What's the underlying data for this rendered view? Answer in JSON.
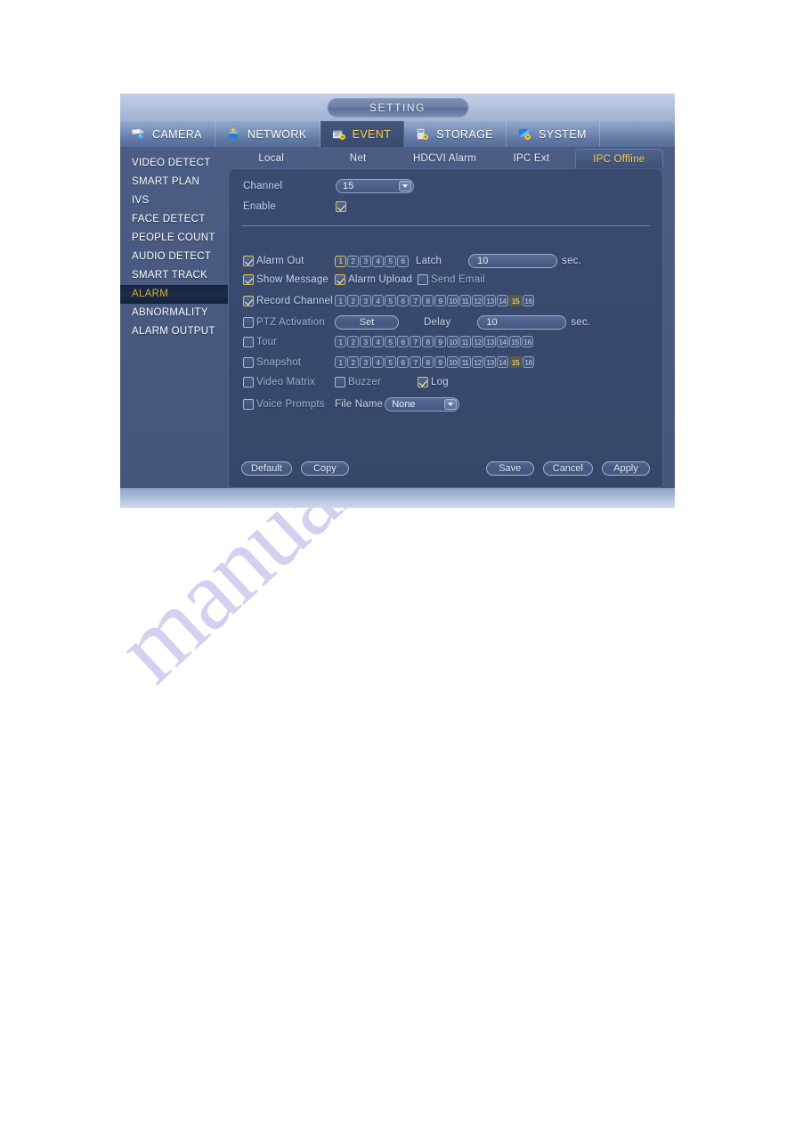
{
  "window": {
    "title": "SETTING"
  },
  "nav": {
    "tabs": [
      {
        "label": "CAMERA",
        "icon": "camera-icon",
        "active": false
      },
      {
        "label": "NETWORK",
        "icon": "network-icon",
        "active": false
      },
      {
        "label": "EVENT",
        "icon": "event-icon",
        "active": true
      },
      {
        "label": "STORAGE",
        "icon": "storage-icon",
        "active": false
      },
      {
        "label": "SYSTEM",
        "icon": "system-icon",
        "active": false
      }
    ]
  },
  "sidebar": {
    "items": [
      {
        "label": "VIDEO DETECT",
        "active": false
      },
      {
        "label": "SMART PLAN",
        "active": false
      },
      {
        "label": "IVS",
        "active": false
      },
      {
        "label": "FACE DETECT",
        "active": false
      },
      {
        "label": "PEOPLE COUNT",
        "active": false
      },
      {
        "label": "AUDIO DETECT",
        "active": false
      },
      {
        "label": "SMART TRACK",
        "active": false
      },
      {
        "label": "ALARM",
        "active": true
      },
      {
        "label": "ABNORMALITY",
        "active": false
      },
      {
        "label": "ALARM OUTPUT",
        "active": false
      }
    ]
  },
  "subtabs": [
    {
      "label": "Local",
      "active": false
    },
    {
      "label": "Net",
      "active": false
    },
    {
      "label": "HDCVI Alarm",
      "active": false
    },
    {
      "label": "IPC Ext",
      "active": false
    },
    {
      "label": "IPC Offline",
      "active": true
    }
  ],
  "form": {
    "channel": {
      "label": "Channel",
      "value": "15"
    },
    "enable": {
      "label": "Enable",
      "checked": true
    },
    "alarm_out": {
      "label": "Alarm Out",
      "checked": true,
      "channels": [
        "1",
        "2",
        "3",
        "4",
        "5",
        "6"
      ],
      "selected": [
        "1"
      ]
    },
    "latch": {
      "label": "Latch",
      "value": "10",
      "unit": "sec."
    },
    "show_message": {
      "label": "Show Message",
      "checked": true
    },
    "alarm_upload": {
      "label": "Alarm Upload",
      "checked": true
    },
    "send_email": {
      "label": "Send Email",
      "checked": false
    },
    "record_channel": {
      "label": "Record Channel",
      "checked": true,
      "channels": [
        "1",
        "2",
        "3",
        "4",
        "5",
        "6",
        "7",
        "8",
        "9",
        "10",
        "11",
        "12",
        "13",
        "14",
        "15",
        "16"
      ],
      "plain": [
        "15"
      ],
      "highlight": [
        "15"
      ]
    },
    "ptz_activation": {
      "label": "PTZ Activation",
      "checked": false,
      "button": "Set"
    },
    "delay": {
      "label": "Delay",
      "value": "10",
      "unit": "sec."
    },
    "tour": {
      "label": "Tour",
      "checked": false,
      "channels": [
        "1",
        "2",
        "3",
        "4",
        "5",
        "6",
        "7",
        "8",
        "9",
        "10",
        "11",
        "12",
        "13",
        "14",
        "15",
        "16"
      ],
      "plain": [],
      "highlight": []
    },
    "snapshot": {
      "label": "Snapshot",
      "checked": false,
      "channels": [
        "1",
        "2",
        "3",
        "4",
        "5",
        "6",
        "7",
        "8",
        "9",
        "10",
        "11",
        "12",
        "13",
        "14",
        "15",
        "16"
      ],
      "plain": [
        "15"
      ],
      "highlight": [
        "15"
      ]
    },
    "video_matrix": {
      "label": "Video Matrix",
      "checked": false
    },
    "buzzer": {
      "label": "Buzzer",
      "checked": false
    },
    "log": {
      "label": "Log",
      "checked": true
    },
    "voice_prompts": {
      "label": "Voice Prompts",
      "checked": false
    },
    "file_name": {
      "label": "File Name",
      "value": "None"
    }
  },
  "footer": {
    "default": "Default",
    "copy": "Copy",
    "save": "Save",
    "cancel": "Cancel",
    "apply": "Apply"
  },
  "watermark": {
    "text": "manualshive.com"
  },
  "colors": {
    "accent_yellow": "#ffd24d",
    "panel_bg": "#38496d",
    "window_bg": "#46587d",
    "active_menu_bg": "#16253f",
    "active_menu_text": "#d8b43a"
  }
}
